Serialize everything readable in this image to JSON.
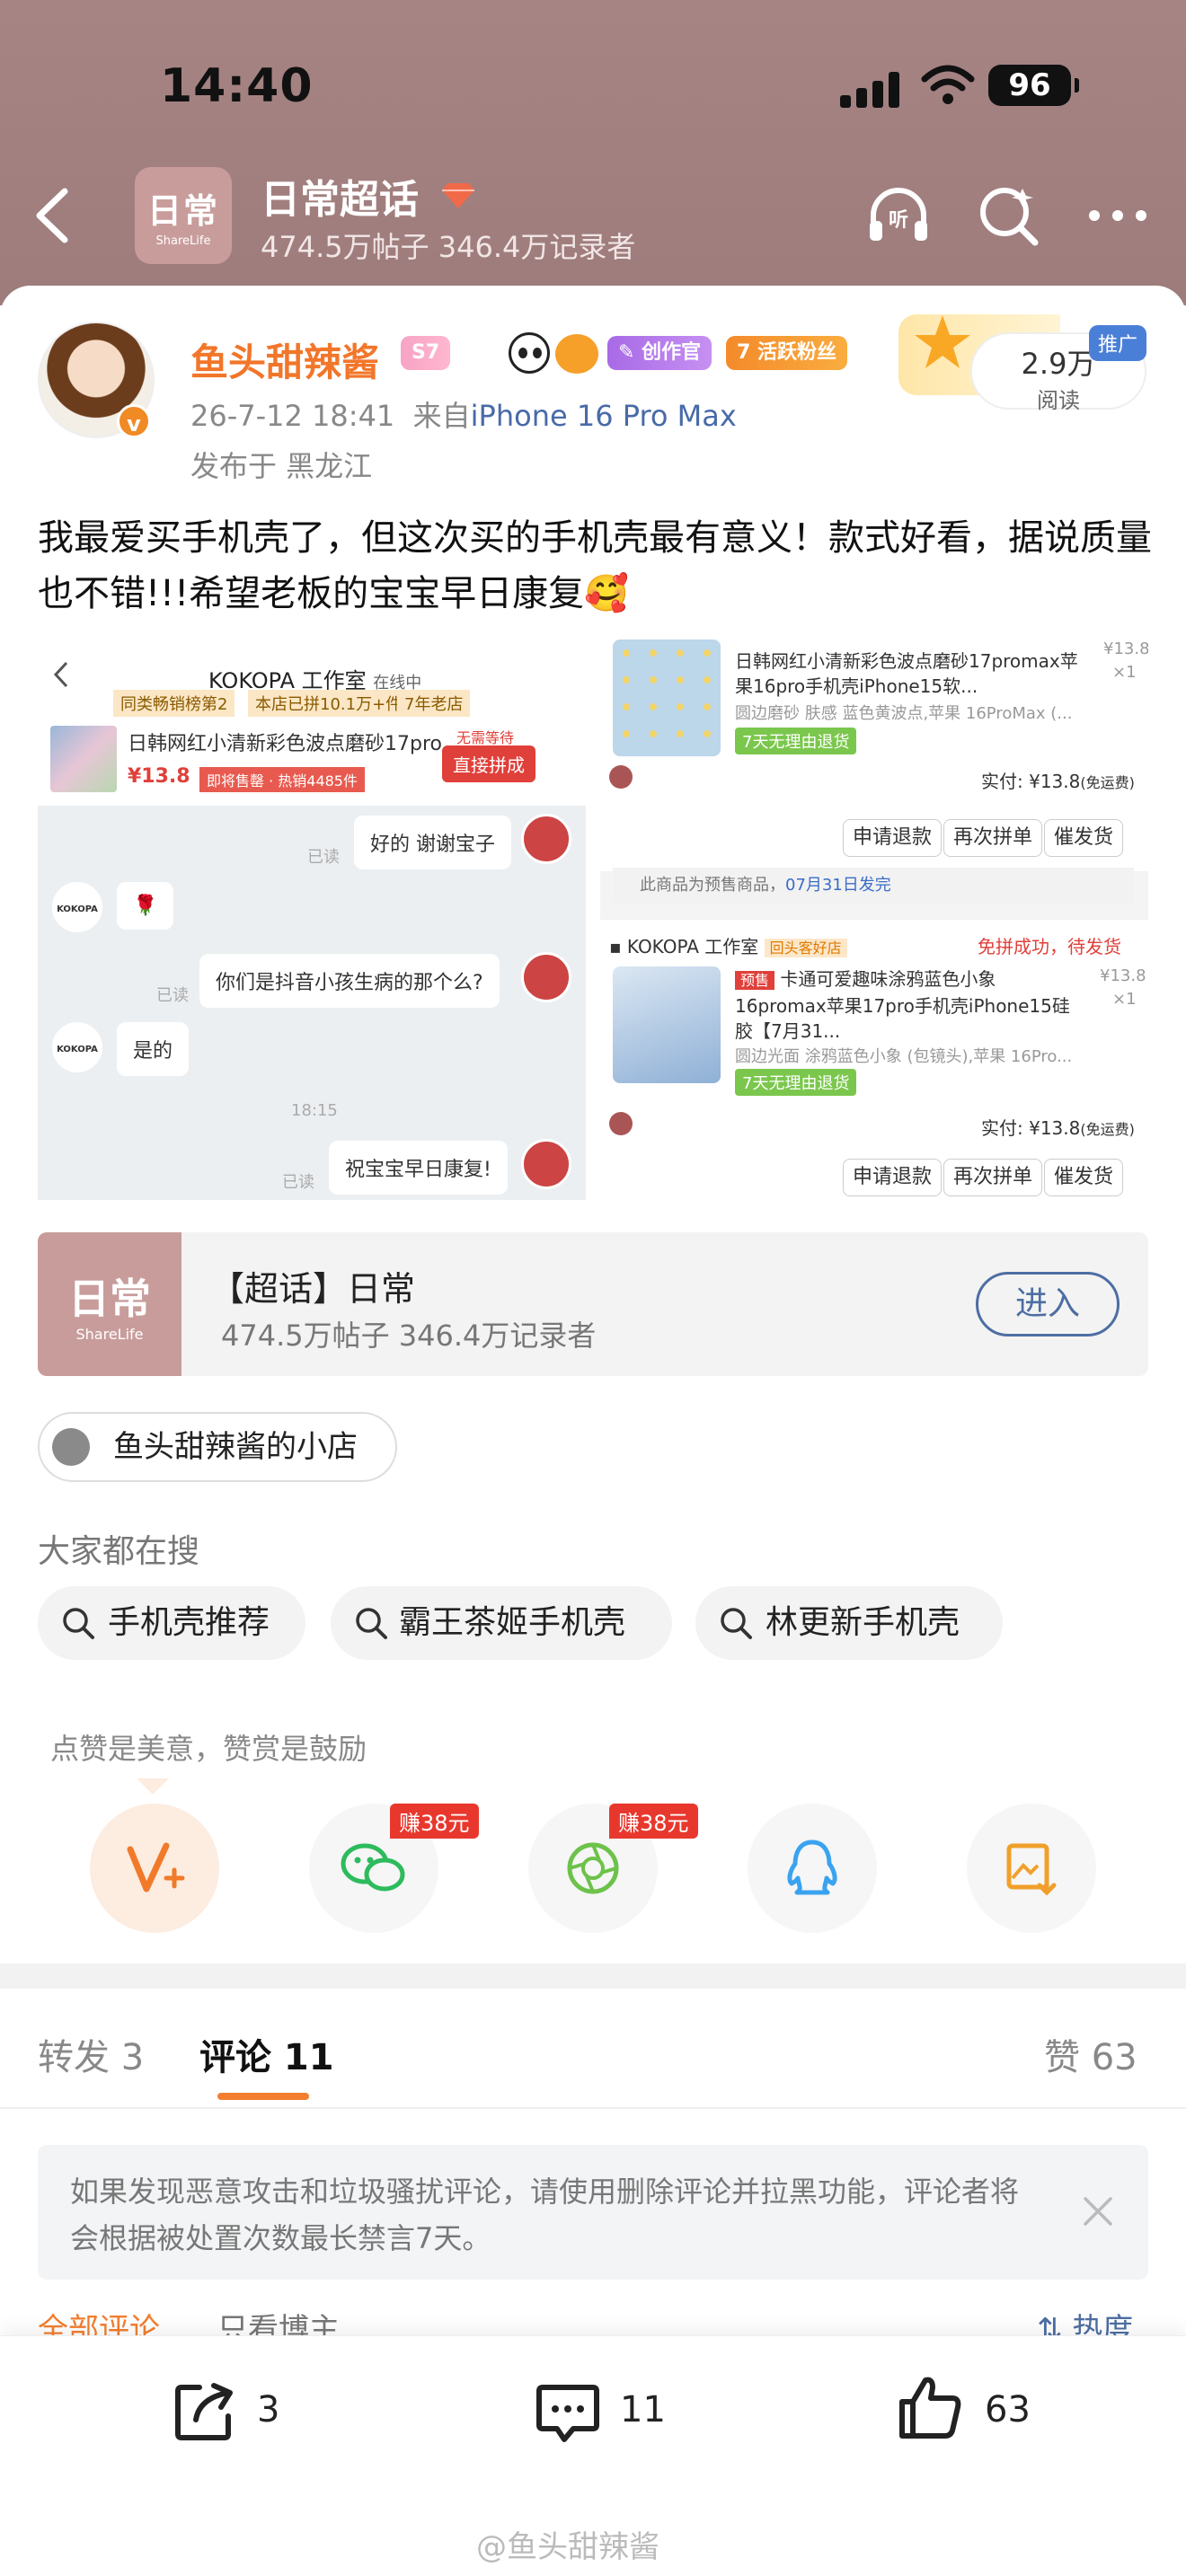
{
  "status_bar": {
    "time": "14:40",
    "battery": "96"
  },
  "header": {
    "logo_text": "日常",
    "logo_sub": "ShareLife",
    "title": "日常超话",
    "subtitle": "474.5万帖子 346.4万记录者"
  },
  "post": {
    "username": "鱼头甜辣酱",
    "badges": [
      "S7",
      "创作官",
      "活跃粉丝"
    ],
    "fan_level": "7",
    "datetime": "26-7-12 18:41",
    "from_label": "来自",
    "device": "iPhone 16 Pro Max",
    "location": "发布于 黑龙江",
    "views_count": "2.9万",
    "views_label": "阅读",
    "ad_label": "推广",
    "content": "我最爱买手机壳了，但这次买的手机壳最有意义！款式好看，据说质量也不错!!!希望老板的宝宝早日康复🥰"
  },
  "image_chat": {
    "shop_name": "KOKOPA 工作室",
    "online": "在线中",
    "tags": [
      "同类畅销榜第2",
      "本店已拼10.1万+件",
      "7年老店"
    ],
    "product_title": "日韩网红小清新彩色波点磨砂17pro...",
    "price": "¥13.8",
    "sold": "即将售罄 · 热销4485件",
    "no_wait": "无需等待",
    "direct": "直接拼成",
    "read1": "已读",
    "msg1": "好的 谢谢宝子",
    "msg2": "🌹",
    "read2": "已读",
    "msg3": "你们是抖音小孩生病的那个么?",
    "msg4": "是的",
    "time": "18:15",
    "read3": "已读",
    "msg5": "祝宝宝早日康复!",
    "kokopa": "KOKOPA"
  },
  "image_orders": {
    "o1_title": "日韩网红小清新彩色波点磨砂17promax苹果16pro手机壳iPhone15软...",
    "o1_spec": "圆边磨砂 肤感 蓝色黄波点,苹果 16ProMax (...",
    "o1_qty": "×1",
    "o1_price_label": "¥13.8",
    "return_label": "7天无理由退货",
    "paid_label": "实付:",
    "paid_price": "¥13.8",
    "free_ship": "(免运费)",
    "btn_refund": "申请退款",
    "btn_again": "再次拼单",
    "btn_urge": "催发货",
    "presale": "此商品为预售商品，",
    "ship_date": "07月31日发完",
    "shop2": "KOKOPA 工作室",
    "shop2_tag": "回头客好店",
    "status2": "免拼成功，待发货",
    "presale_tag": "预售",
    "o2_title": "卡通可爱趣味涂鸦蓝色小象16promax苹果17pro手机壳iPhone15硅胶【7月31...",
    "o2_spec": "圆边光面 涂鸦蓝色小象 (包镜头),苹果 16Pro...",
    "o2_price": "¥13.8",
    "o2_qty": "×1"
  },
  "topic_card": {
    "logo_text": "日常",
    "logo_sub": "ShareLife",
    "title": "【超话】日常",
    "subtitle": "474.5万帖子 346.4万记录者",
    "enter_label": "进入"
  },
  "shop_link": "鱼头甜辣酱的小店",
  "search": {
    "title": "大家都在搜",
    "chips": [
      "手机壳推荐",
      "霸王茶姬手机壳",
      "林更新手机壳"
    ]
  },
  "reward": {
    "hint": "点赞是美意，赞赏是鼓励",
    "earn1": "赚38元",
    "earn2": "赚38元"
  },
  "tabs": {
    "repost": "转发 3",
    "comment": "评论 11",
    "like": "赞 63"
  },
  "notice": "如果发现恶意攻击和垃圾骚扰评论，请使用删除评论并拉黑功能，评论者将会根据被处置次数最长禁言7天。",
  "filter": {
    "all": "全部评论",
    "author_only": "只看博主",
    "sort": "热度"
  },
  "bottom_bar": {
    "repost": "3",
    "comment": "11",
    "like": "63"
  },
  "watermark": "@鱼头甜辣酱",
  "colors": {
    "header": "#a78484",
    "username": "#f2762a",
    "link": "#486aa8",
    "accent": "#f37e2f",
    "earn": "#e8382e"
  }
}
